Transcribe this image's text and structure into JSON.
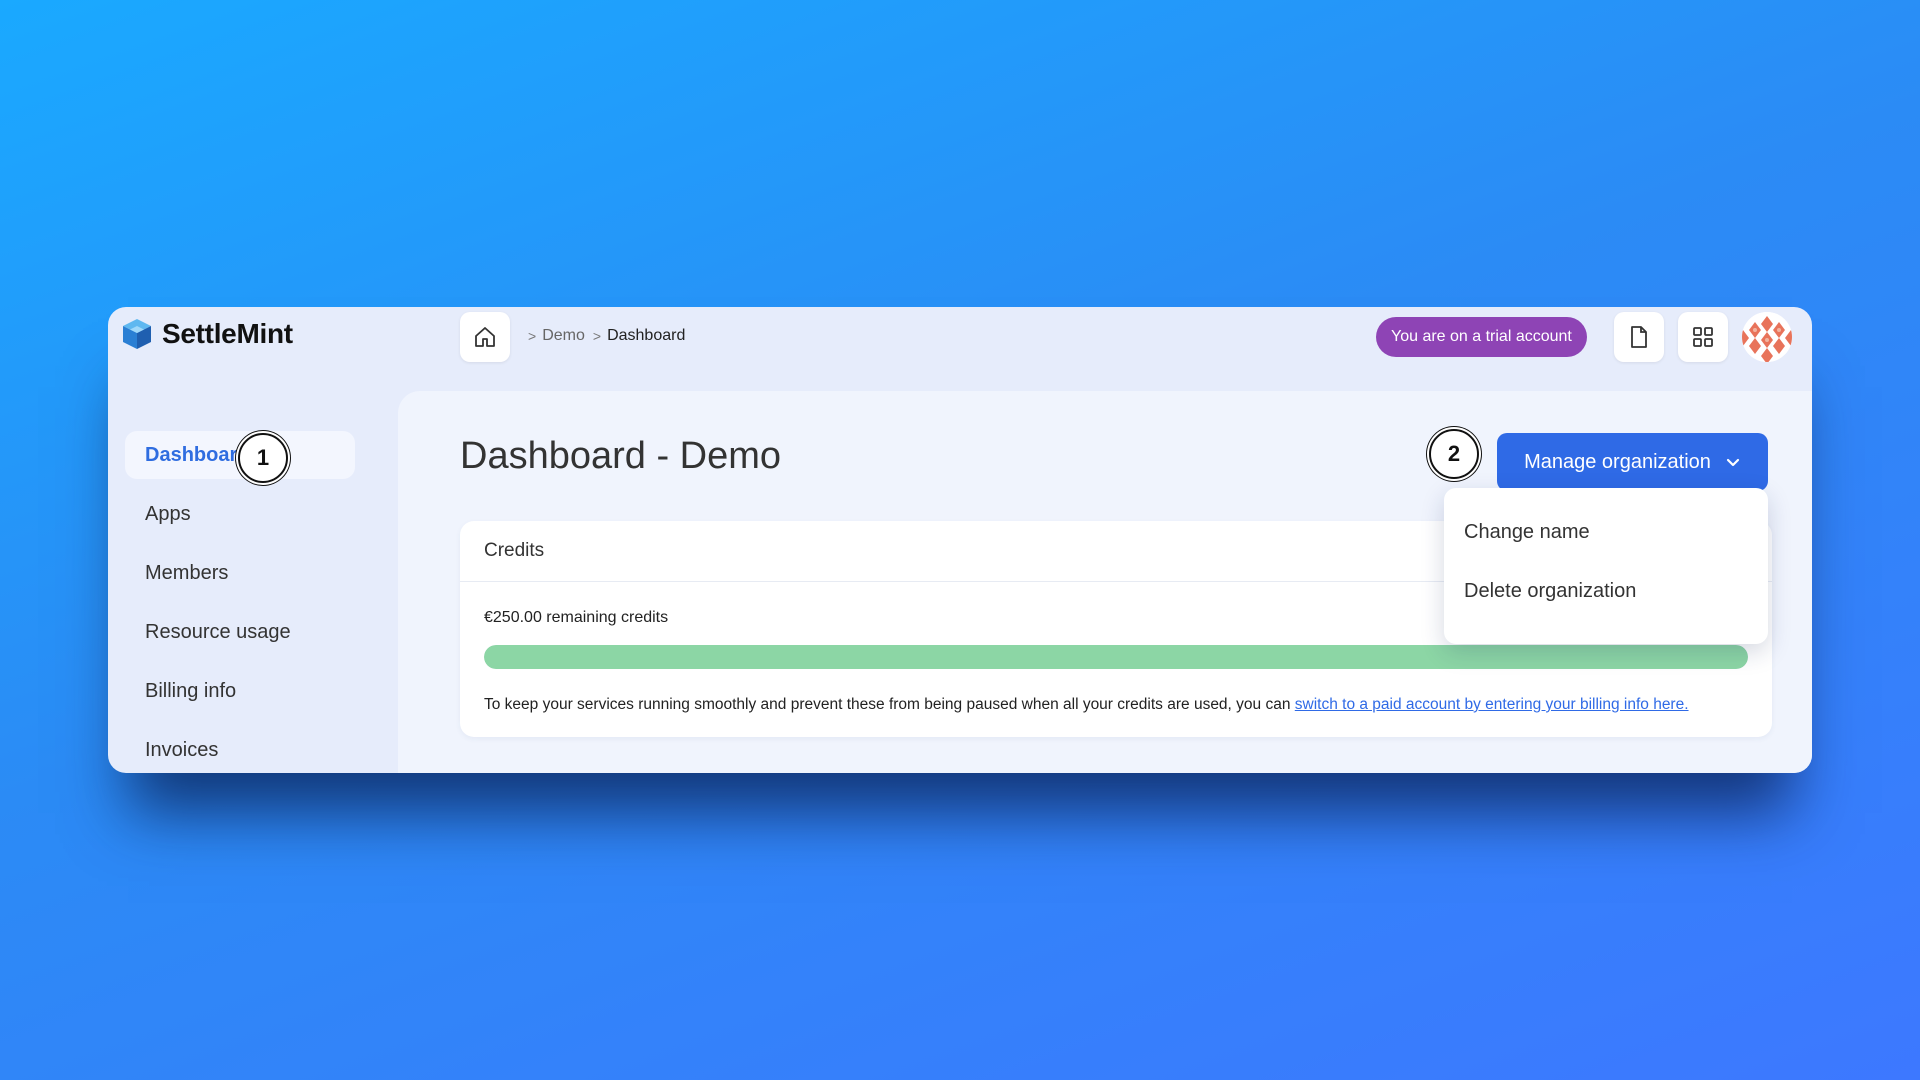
{
  "app": {
    "name": "SettleMint"
  },
  "breadcrumb": {
    "items": [
      "Demo",
      "Dashboard"
    ]
  },
  "header": {
    "trial_badge": "You are on a trial account"
  },
  "sidebar": {
    "items": [
      {
        "label": "Dashboard",
        "active": true
      },
      {
        "label": "Apps"
      },
      {
        "label": "Members"
      },
      {
        "label": "Resource usage"
      },
      {
        "label": "Billing info"
      },
      {
        "label": "Invoices"
      }
    ]
  },
  "main": {
    "title": "Dashboard - Demo",
    "manage_button": "Manage organization",
    "credits": {
      "title": "Credits",
      "remaining": "€250.00 remaining credits",
      "progress_fraction": 1.0,
      "note": "To keep your services running smoothly and prevent these from being paused when all your credits are used, you can ",
      "link": "switch to a paid account by entering your billing info here."
    }
  },
  "dropdown": {
    "items": [
      "Change name",
      "Delete organization"
    ]
  },
  "steps": {
    "one": "1",
    "two": "2"
  },
  "colors": {
    "accent": "#2f6ae6",
    "trial_badge": "#8e44b5",
    "progress": "#8cd6a5"
  },
  "icons": [
    "settlemint-logo-icon",
    "home-icon",
    "document-icon",
    "grid-icon",
    "chevron-down-icon"
  ]
}
